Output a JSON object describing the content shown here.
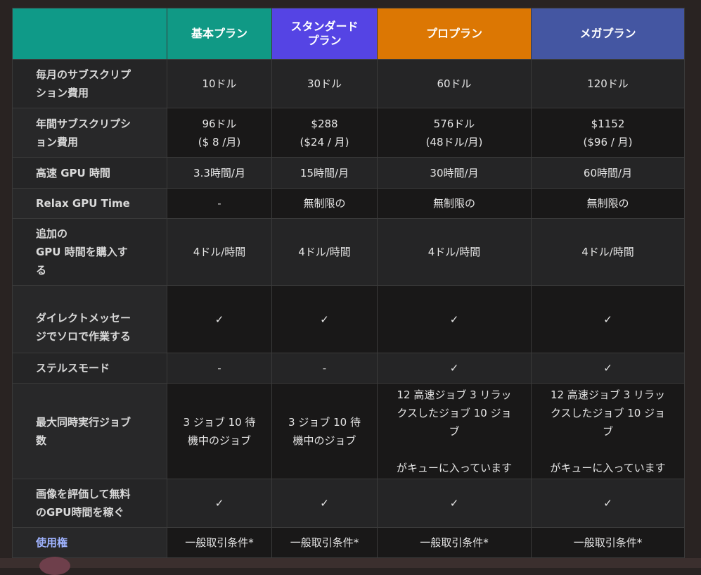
{
  "header": {
    "corner": "",
    "plans": [
      {
        "name": "基本プラン",
        "color": "#109985"
      },
      {
        "name": "スタンダード\nプラン",
        "color": "#5544e4"
      },
      {
        "name": "プロプラン",
        "color": "#dc7703"
      },
      {
        "name": "メガプラン",
        "color": "#4456a2"
      }
    ]
  },
  "rows": [
    {
      "label": "毎月のサブスクリプ\nション費用",
      "values": [
        "10ドル",
        "30ドル",
        "60ドル",
        "120ドル"
      ]
    },
    {
      "label": "年間サブスクリプシ\nョン費用",
      "values": [
        "96ドル\n($ 8 /月)",
        "$288\n($24 / 月)",
        "576ドル\n(48ドル/月)",
        "$1152\n($96 / 月)"
      ]
    },
    {
      "label": "高速 GPU 時間",
      "values": [
        "3.3時間/月",
        "15時間/月",
        "30時間/月",
        "60時間/月"
      ]
    },
    {
      "label": "Relax GPU Time",
      "values": [
        "-",
        "無制限の",
        "無制限の",
        "無制限の"
      ]
    },
    {
      "label": "追加の\nGPU 時間を購入す\nる",
      "values": [
        "4ドル/時間",
        "4ドル/時間",
        "4ドル/時間",
        "4ドル/時間"
      ]
    },
    {
      "label": "ダイレクトメッセー\nジでソロで作業する",
      "values": [
        "✓",
        "✓",
        "✓",
        "✓"
      ]
    },
    {
      "label": "ステルスモード",
      "values": [
        "-",
        "-",
        "✓",
        "✓"
      ]
    },
    {
      "label": "最大同時実行ジョブ\n数",
      "values": [
        "3 ジョブ 10 待\n機中のジョブ",
        "3 ジョブ 10 待\n機中のジョブ",
        "12 高速ジョブ 3 リラッ\nクスしたジョブ 10 ジョ\nブ\n\nがキューに入っています",
        "12 高速ジョブ 3 リラッ\nクスしたジョブ 10 ジョ\nブ\n\nがキューに入っています"
      ]
    },
    {
      "label": "画像を評価して無料\nのGPU時間を稼ぐ",
      "values": [
        "✓",
        "✓",
        "✓",
        "✓"
      ]
    },
    {
      "label": "使用権",
      "values": [
        "一般取引条件*",
        "一般取引条件*",
        "一般取引条件*",
        "一般取引条件*"
      ]
    }
  ],
  "colors": {
    "page_background": "#292322",
    "row_dark": "#191818",
    "row_light": "#252526",
    "link_label": "#9fb3ff"
  }
}
